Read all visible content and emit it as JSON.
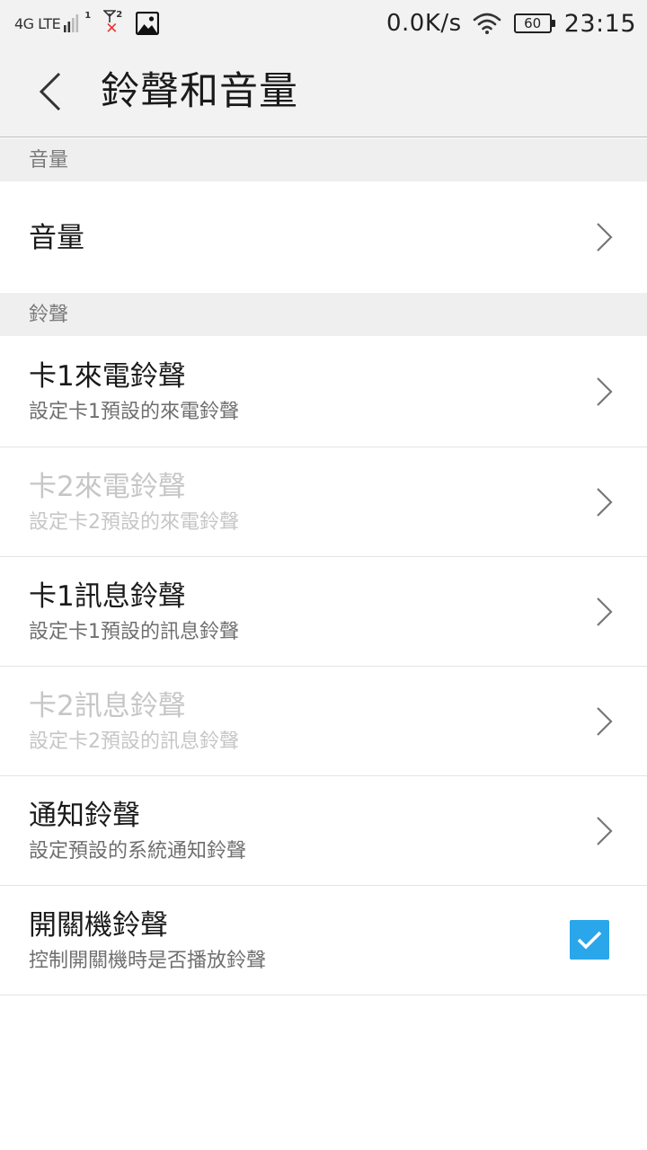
{
  "status_bar": {
    "network_type": "4G LTE",
    "sim1_tag": "1",
    "sim2_tag": "2",
    "sim2_status": "✕",
    "net_speed": "0.0K/s",
    "battery": "60",
    "time": "23:15"
  },
  "header": {
    "title": "鈴聲和音量"
  },
  "sections": {
    "volume": {
      "header": "音量",
      "item": {
        "title": "音量"
      }
    },
    "ringtone": {
      "header": "鈴聲",
      "items": [
        {
          "title": "卡1來電鈴聲",
          "subtitle": "設定卡1預設的來電鈴聲"
        },
        {
          "title": "卡2來電鈴聲",
          "subtitle": "設定卡2預設的來電鈴聲"
        },
        {
          "title": "卡1訊息鈴聲",
          "subtitle": "設定卡1預設的訊息鈴聲"
        },
        {
          "title": "卡2訊息鈴聲",
          "subtitle": "設定卡2預設的訊息鈴聲"
        },
        {
          "title": "通知鈴聲",
          "subtitle": "設定預設的系統通知鈴聲"
        },
        {
          "title": "開關機鈴聲",
          "subtitle": "控制開關機時是否播放鈴聲",
          "checked": true
        }
      ]
    }
  },
  "colors": {
    "accent": "#2aa6ea",
    "disabled_text": "#c6c6c6",
    "error_red": "#e53935"
  }
}
